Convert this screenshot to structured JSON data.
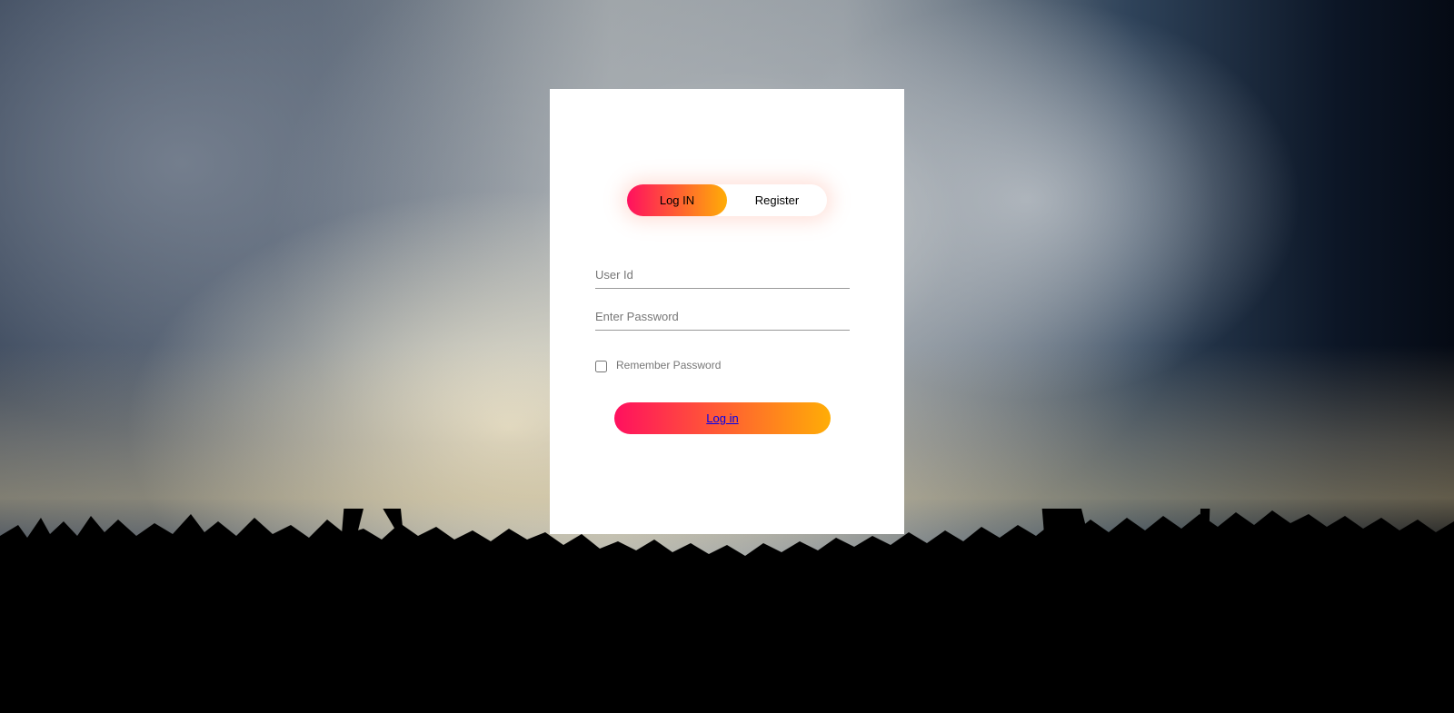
{
  "toggle": {
    "login_label": "Log IN",
    "register_label": "Register"
  },
  "form": {
    "user_placeholder": "User Id",
    "password_placeholder": "Enter Password",
    "remember_label": "Remember Password",
    "submit_label": "Log in"
  },
  "colors": {
    "gradient_start": "#ff105f",
    "gradient_end": "#ffad06",
    "card_background": "#ffffff"
  }
}
